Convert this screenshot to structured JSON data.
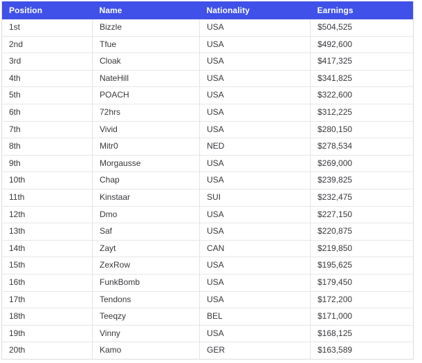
{
  "table": {
    "name": "earnings-leaderboard",
    "header_background": "#3f51e8",
    "header_text_color": "#ffffff",
    "row_text_color": "#37383c",
    "border_color": "#e6e6e8",
    "columns": [
      {
        "key": "position",
        "label": "Position"
      },
      {
        "key": "name",
        "label": "Name"
      },
      {
        "key": "nationality",
        "label": "Nationality"
      },
      {
        "key": "earnings",
        "label": "Earnings"
      }
    ],
    "rows": [
      {
        "position": "1st",
        "name": "Bizzle",
        "nationality": "USA",
        "earnings": "$504,525"
      },
      {
        "position": "2nd",
        "name": "Tfue",
        "nationality": "USA",
        "earnings": "$492,600"
      },
      {
        "position": "3rd",
        "name": "Cloak",
        "nationality": "USA",
        "earnings": "$417,325"
      },
      {
        "position": "4th",
        "name": "NateHill",
        "nationality": "USA",
        "earnings": "$341,825"
      },
      {
        "position": "5th",
        "name": "POACH",
        "nationality": "USA",
        "earnings": "$322,600"
      },
      {
        "position": "6th",
        "name": "72hrs",
        "nationality": "USA",
        "earnings": "$312,225"
      },
      {
        "position": "7th",
        "name": "Vivid",
        "nationality": "USA",
        "earnings": "$280,150"
      },
      {
        "position": "8th",
        "name": "Mitr0",
        "nationality": "NED",
        "earnings": "$278,534"
      },
      {
        "position": "9th",
        "name": "Morgausse",
        "nationality": "USA",
        "earnings": "$269,000"
      },
      {
        "position": "10th",
        "name": "Chap",
        "nationality": "USA",
        "earnings": "$239,825"
      },
      {
        "position": "11th",
        "name": "Kinstaar",
        "nationality": "SUI",
        "earnings": "$232,475"
      },
      {
        "position": "12th",
        "name": "Dmo",
        "nationality": "USA",
        "earnings": "$227,150"
      },
      {
        "position": "13th",
        "name": "Saf",
        "nationality": "USA",
        "earnings": "$220,875"
      },
      {
        "position": "14th",
        "name": "Zayt",
        "nationality": "CAN",
        "earnings": "$219,850"
      },
      {
        "position": "15th",
        "name": "ZexRow",
        "nationality": "USA",
        "earnings": "$195,625"
      },
      {
        "position": "16th",
        "name": "FunkBomb",
        "nationality": "USA",
        "earnings": "$179,450"
      },
      {
        "position": "17th",
        "name": "Tendons",
        "nationality": "USA",
        "earnings": "$172,200"
      },
      {
        "position": "18th",
        "name": "Teeqzy",
        "nationality": "BEL",
        "earnings": "$171,000"
      },
      {
        "position": "19th",
        "name": "Vinny",
        "nationality": "USA",
        "earnings": "$168,125"
      },
      {
        "position": "20th",
        "name": "Kamo",
        "nationality": "GER",
        "earnings": "$163,589"
      }
    ]
  }
}
